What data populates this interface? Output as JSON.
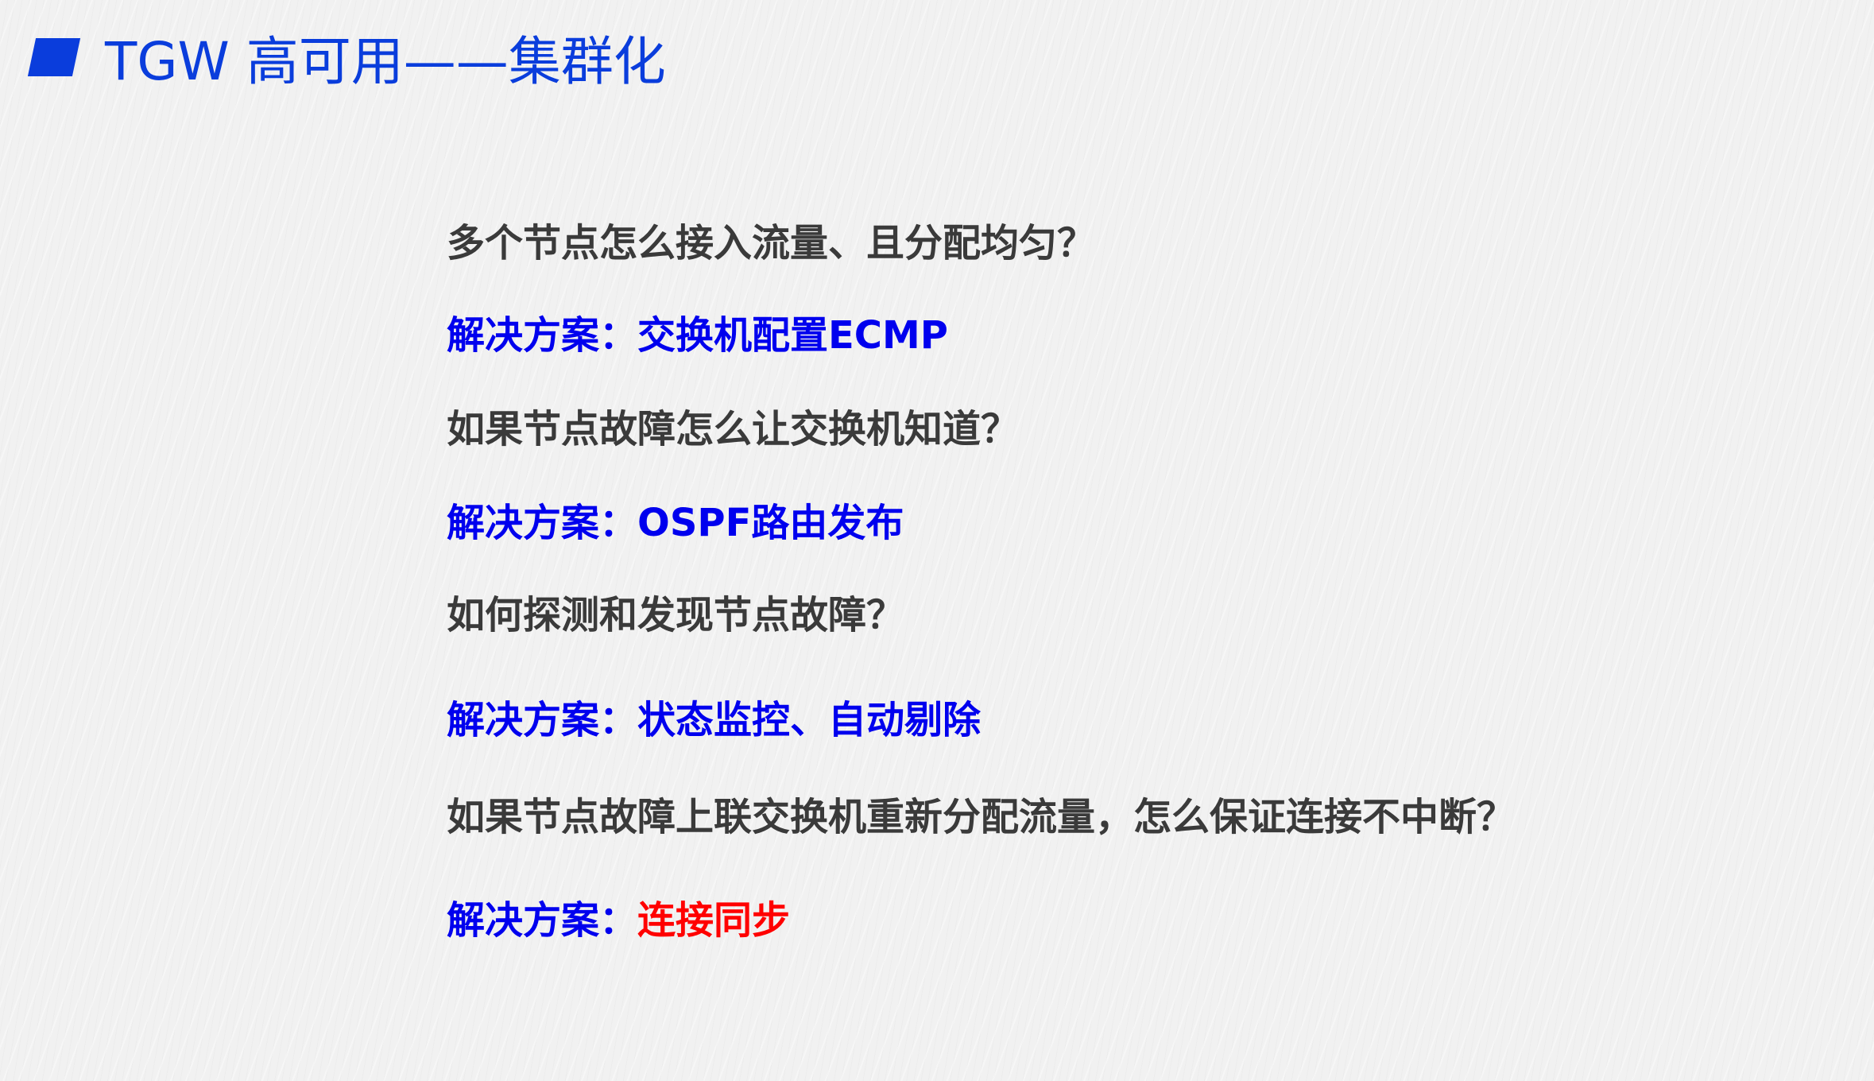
{
  "slide": {
    "title": "TGW 高可用——集群化",
    "accent_color": "#0a3ddc",
    "question_color": "#3a3a3a",
    "answer_color": "#0000ee",
    "highlight_color": "#ff0000"
  },
  "items": [
    {
      "question": "多个节点怎么接入流量、且分配均匀？",
      "answer_prefix": "解决方案：",
      "answer": "交换机配置ECMP"
    },
    {
      "question": "如果节点故障怎么让交换机知道？",
      "answer_prefix": "解决方案：",
      "answer": "OSPF路由发布"
    },
    {
      "question": "如何探测和发现节点故障？",
      "answer_prefix": "解决方案：",
      "answer": "状态监控、自动剔除"
    },
    {
      "question": "如果节点故障上联交换机重新分配流量，怎么保证连接不中断？",
      "answer_prefix": "解决方案：",
      "answer": "连接同步"
    }
  ]
}
